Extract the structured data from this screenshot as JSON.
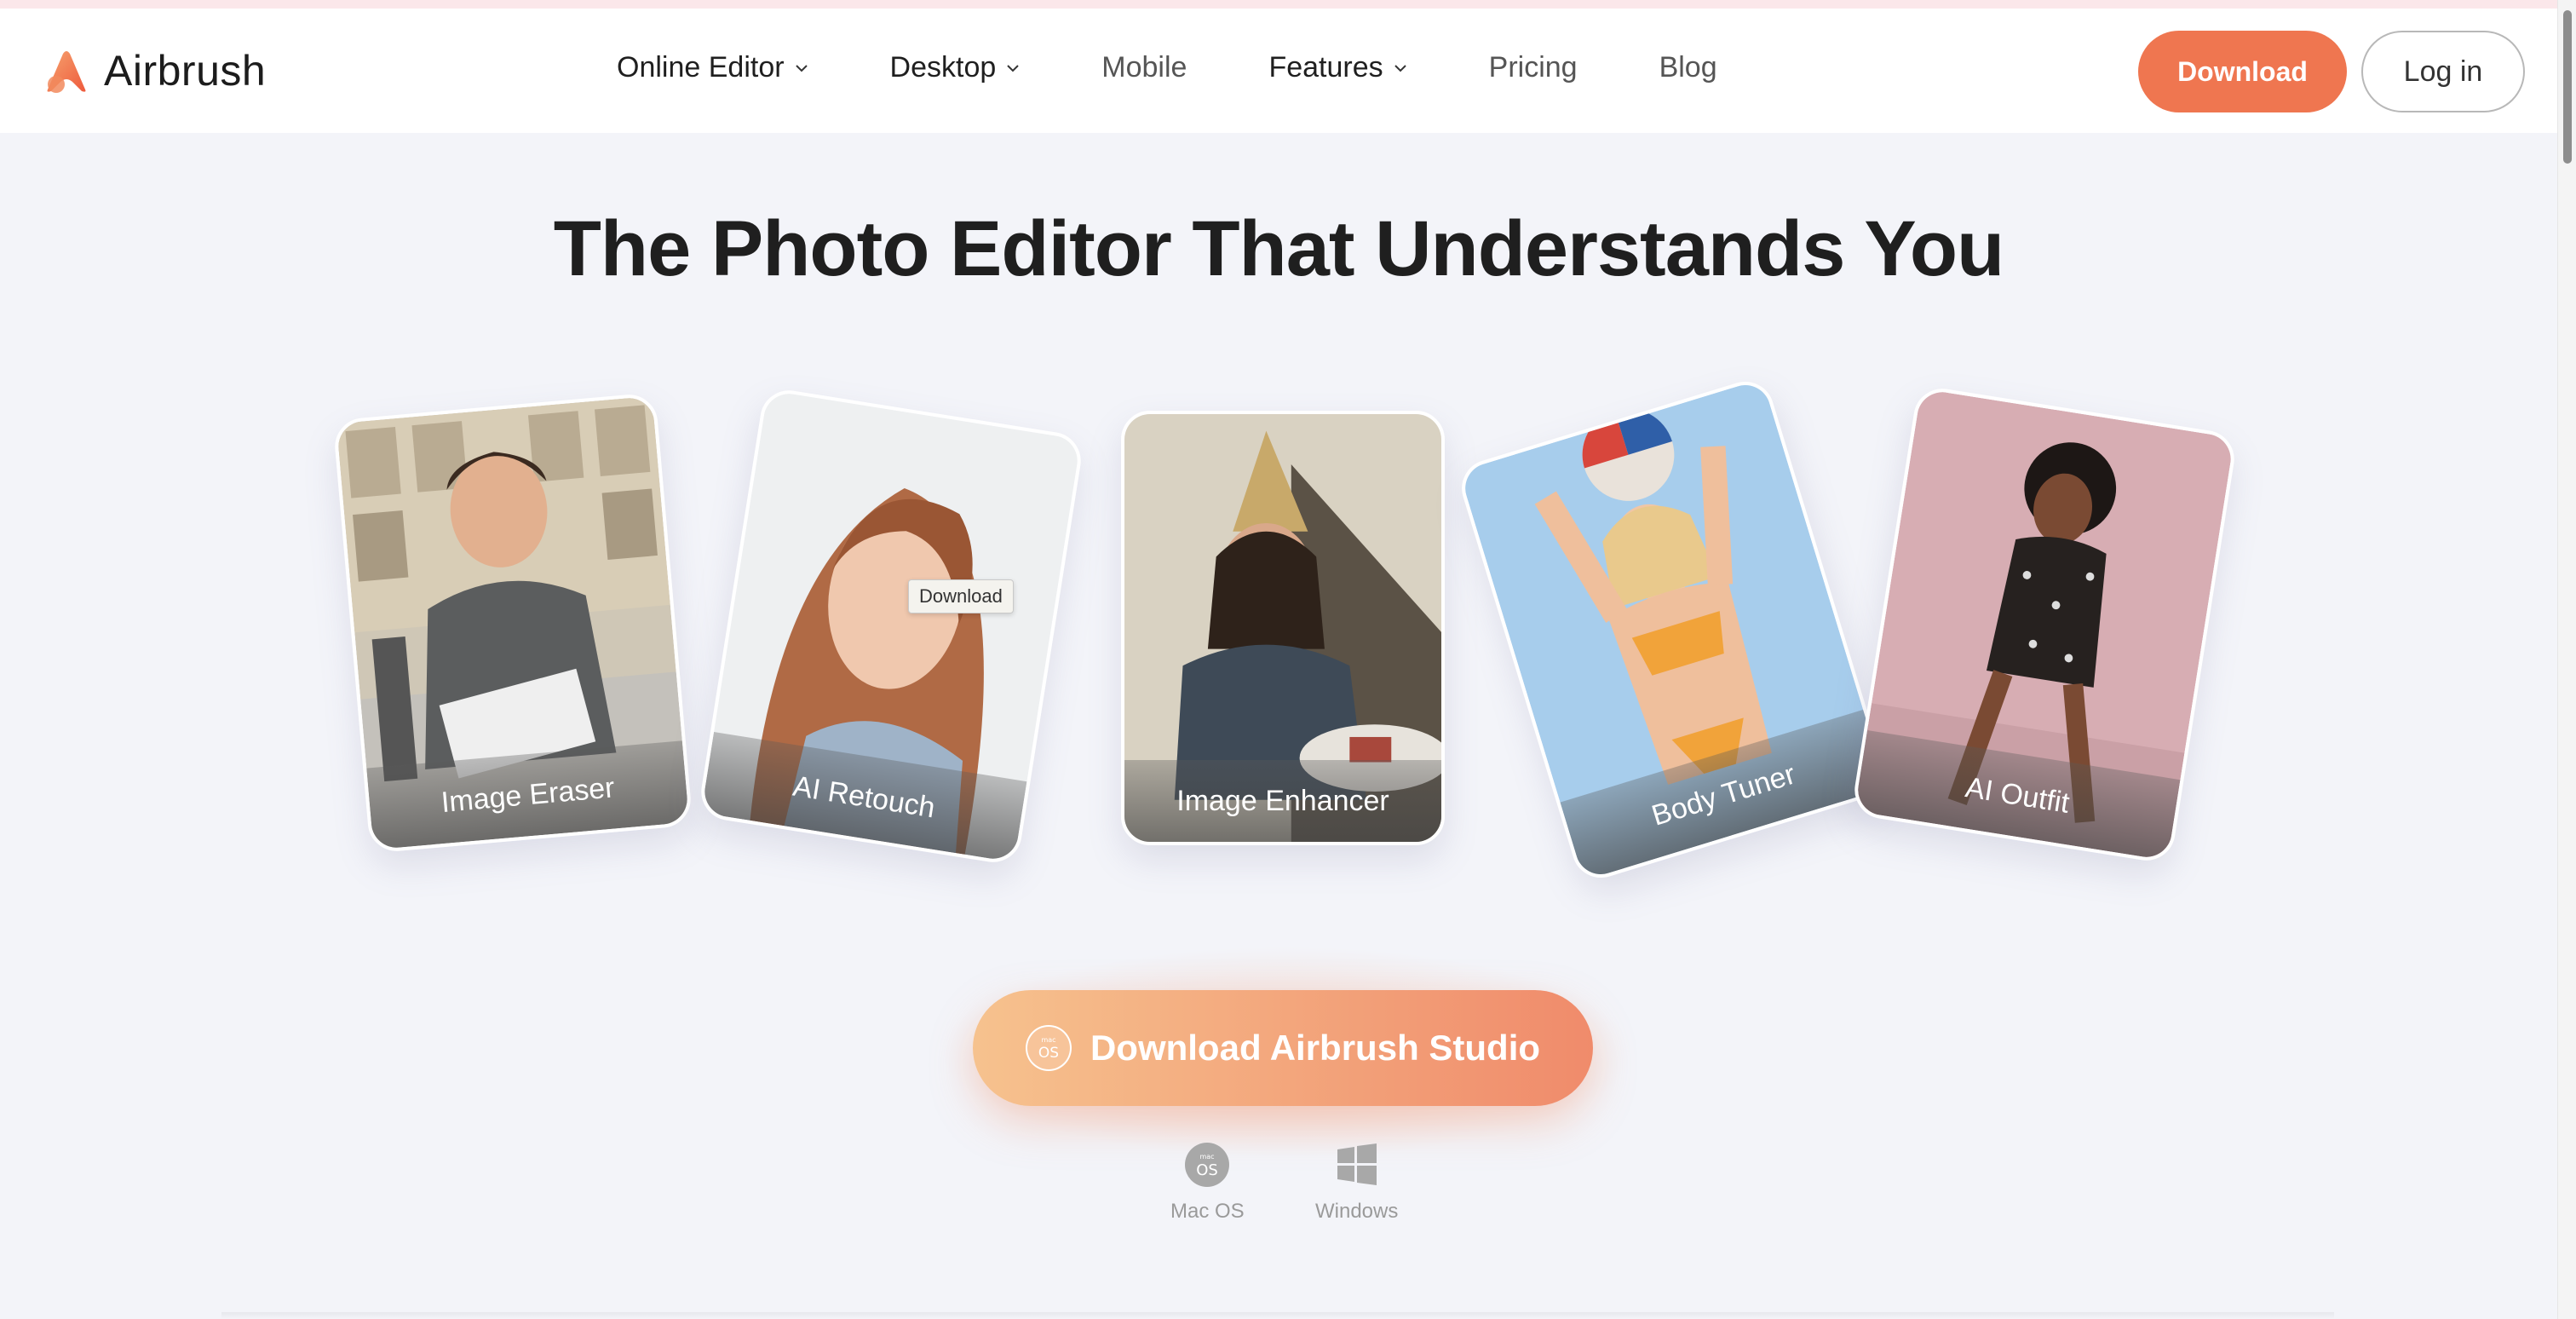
{
  "brand": {
    "name": "Airbrush",
    "accent": "#ef7650"
  },
  "nav": {
    "items": [
      {
        "label": "Online Editor",
        "has_dropdown": true
      },
      {
        "label": "Desktop",
        "has_dropdown": true
      },
      {
        "label": "Mobile",
        "has_dropdown": false
      },
      {
        "label": "Features",
        "has_dropdown": true
      },
      {
        "label": "Pricing",
        "has_dropdown": false
      },
      {
        "label": "Blog",
        "has_dropdown": false
      }
    ],
    "download_label": "Download",
    "login_label": "Log in"
  },
  "hero": {
    "headline": "The Photo Editor That Understands You",
    "cards": [
      {
        "label": "Image Eraser"
      },
      {
        "label": "AI Retouch"
      },
      {
        "label": "Image Enhancer"
      },
      {
        "label": "Body Tuner"
      },
      {
        "label": "AI Outfit"
      }
    ],
    "tooltip": "Download"
  },
  "cta": {
    "label": "Download Airbrush Studio",
    "icon": "macos-icon",
    "platforms": [
      {
        "name": "Mac OS",
        "icon": "macos-icon"
      },
      {
        "name": "Windows",
        "icon": "windows-icon"
      }
    ]
  }
}
